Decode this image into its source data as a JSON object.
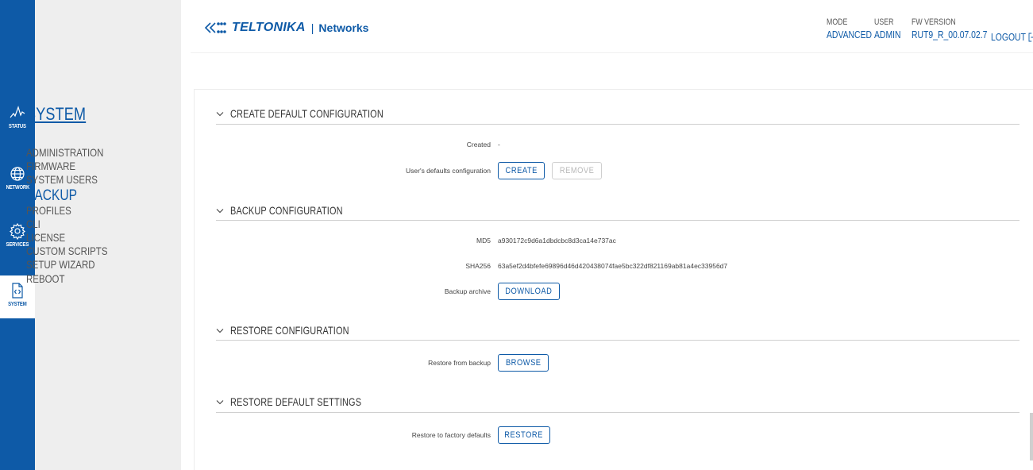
{
  "rail": {
    "items": [
      {
        "label": "STATUS",
        "icon": "status-icon"
      },
      {
        "label": "NETWORK",
        "icon": "globe-icon"
      },
      {
        "label": "SERVICES",
        "icon": "gear-icon"
      },
      {
        "label": "SYSTEM",
        "icon": "code-file-icon",
        "active": true
      }
    ]
  },
  "subnav": {
    "title": "SYSTEM",
    "items": [
      {
        "label": "ADMINISTRATION"
      },
      {
        "label": "FIRMWARE"
      },
      {
        "label": "SYSTEM USERS"
      },
      {
        "label": "BACKUP",
        "active": true
      },
      {
        "label": "PROFILES"
      },
      {
        "label": "CLI"
      },
      {
        "label": "LICENSE"
      },
      {
        "label": "CUSTOM SCRIPTS"
      },
      {
        "label": "SETUP WIZARD"
      },
      {
        "label": "REBOOT"
      }
    ]
  },
  "header": {
    "brand": "TELTONIKA",
    "separator": "|",
    "networks": "Networks",
    "mode_label": "MODE",
    "mode_value": "ADVANCED",
    "user_label": "USER",
    "user_value": "ADMIN",
    "fw_label": "FW VERSION",
    "fw_value": "RUT9_R_00.07.02.7",
    "logout": "LOGOUT"
  },
  "sections": {
    "create_default": {
      "title": "CREATE DEFAULT CONFIGURATION",
      "created_label": "Created",
      "created_value": "-",
      "defaults_label": "User's defaults configuration",
      "create_button": "CREATE",
      "remove_button": "REMOVE"
    },
    "backup": {
      "title": "BACKUP CONFIGURATION",
      "md5_label": "MD5",
      "md5_value": "a930172c9d6a1dbdcbc8d3ca14e737ac",
      "sha256_label": "SHA256",
      "sha256_value": "63a5ef2d4bfefe69896d46d420438074fae5bc322df821169ab81a4ec33956d7",
      "archive_label": "Backup archive",
      "download_button": "DOWNLOAD"
    },
    "restore_config": {
      "title": "RESTORE CONFIGURATION",
      "restore_label": "Restore from backup",
      "browse_button": "BROWSE"
    },
    "restore_defaults": {
      "title": "RESTORE DEFAULT SETTINGS",
      "factory_label": "Restore to factory defaults",
      "restore_button": "RESTORE"
    }
  },
  "colors": {
    "accent": "#0e5aa7",
    "rail_bg": "#0e5aa7",
    "subnav_bg": "#eeeeee",
    "disabled": "#b8b8b8"
  }
}
